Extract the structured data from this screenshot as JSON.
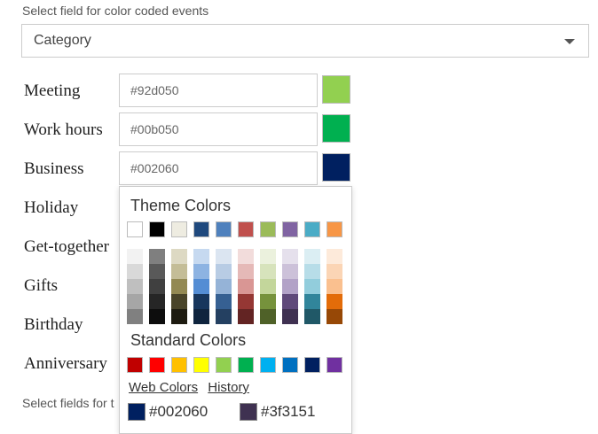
{
  "top_label": "Select field for color coded events",
  "category_select": {
    "value": "Category"
  },
  "rows": [
    {
      "label": "Meeting",
      "hex": "#92d050",
      "color": "#92d050"
    },
    {
      "label": "Work hours",
      "hex": "#00b050",
      "color": "#00b050"
    },
    {
      "label": "Business",
      "hex": "#002060",
      "color": "#002060"
    },
    {
      "label": "Holiday"
    },
    {
      "label": "Get-together"
    },
    {
      "label": "Gifts"
    },
    {
      "label": "Birthday"
    },
    {
      "label": "Anniversary"
    }
  ],
  "bottom_label": "Select fields for t",
  "picker": {
    "theme_title": "Theme Colors",
    "theme_colors": [
      "#ffffff",
      "#000000",
      "#eeece1",
      "#1f497d",
      "#4f81bd",
      "#c0504d",
      "#9bbb59",
      "#8064a2",
      "#4bacc6",
      "#f79646"
    ],
    "theme_shades": [
      [
        "#f2f2f2",
        "#d9d9d9",
        "#bfbfbf",
        "#a6a6a6",
        "#808080"
      ],
      [
        "#7f7f7f",
        "#595959",
        "#404040",
        "#262626",
        "#0d0d0d"
      ],
      [
        "#ddd9c3",
        "#c4bd97",
        "#938953",
        "#494429",
        "#1d1b10"
      ],
      [
        "#c6d9f0",
        "#8db3e2",
        "#548dd4",
        "#17365d",
        "#0f243e"
      ],
      [
        "#dbe5f1",
        "#b8cce4",
        "#95b3d7",
        "#366092",
        "#244061"
      ],
      [
        "#f2dcdb",
        "#e5b9b7",
        "#d99694",
        "#953734",
        "#632423"
      ],
      [
        "#ebf1dd",
        "#d7e3bc",
        "#c3d69b",
        "#76923c",
        "#4f6128"
      ],
      [
        "#e5e0ec",
        "#ccc1d9",
        "#b2a2c7",
        "#5f497a",
        "#3f3151"
      ],
      [
        "#dbeef3",
        "#b7dde8",
        "#92cddc",
        "#31859b",
        "#205867"
      ],
      [
        "#fdeada",
        "#fbd5b5",
        "#fac08f",
        "#e36c09",
        "#974806"
      ]
    ],
    "standard_title": "Standard Colors",
    "standard_colors": [
      "#c00000",
      "#ff0000",
      "#ffc000",
      "#ffff00",
      "#92d050",
      "#00b050",
      "#00b0f0",
      "#0070c0",
      "#002060",
      "#7030a0"
    ],
    "web_colors_link": "Web Colors",
    "history_link": "History",
    "recent": [
      {
        "label": "#002060",
        "color": "#002060"
      },
      {
        "label": "#3f3151",
        "color": "#3f3151"
      }
    ]
  }
}
